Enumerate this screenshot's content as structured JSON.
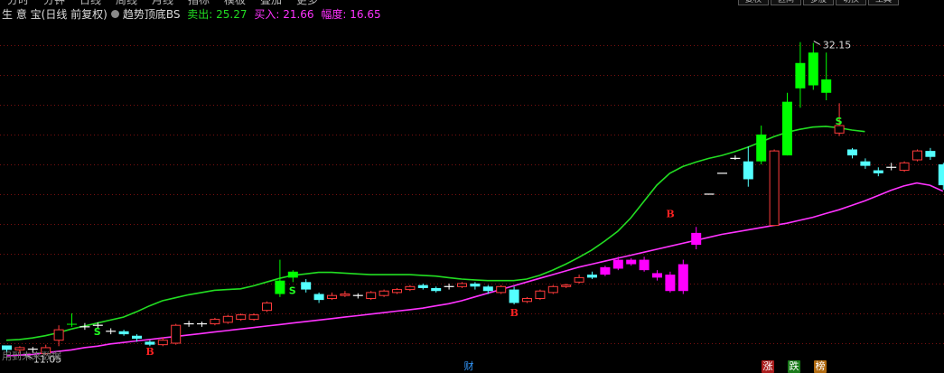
{
  "menu": {
    "items": [
      "分时",
      "分钟",
      "日线",
      "周线",
      "月线",
      "指标",
      "模板",
      "叠加",
      "更多"
    ],
    "buttons": [
      "复权",
      "区间",
      "多股",
      "切换",
      "工具"
    ]
  },
  "header": {
    "stock_name": "生 意 宝",
    "period_label": "(日线 前复权)",
    "indicator_name": "趋势顶底BS",
    "sell_text": "卖出: 25.27",
    "buy_text": "买入: 21.66",
    "amplitude_text": "幅度: 16.65"
  },
  "footer": {
    "note": "用到未来数据"
  },
  "markers": {
    "cai": "财",
    "zhang": "涨",
    "die": "跌",
    "bang": "榜"
  },
  "colors": {
    "background": "#000000",
    "grid": "#7a1010",
    "up_candle": "#ff3b3b",
    "down_candle": "#54ffff",
    "upper_band": "#22dd22",
    "lower_band": "#ff33ff",
    "sell_candle": "#00ff00",
    "buy_candle": "#ff00ff",
    "buy_signal": "#ff2222",
    "sell_signal": "#22ff22",
    "annotation": "#dddddd"
  },
  "chart_data": {
    "type": "candlestick",
    "ylim": [
      10,
      34.3
    ],
    "grid_y": [
      32,
      30,
      28,
      26,
      24,
      22,
      20,
      18,
      16,
      14,
      12
    ],
    "candles": [
      {
        "o": 11.85,
        "c": 11.55,
        "h": 11.85,
        "l": 11.4,
        "t": "down"
      },
      {
        "o": 11.55,
        "c": 11.7,
        "h": 11.8,
        "l": 11.3,
        "t": "up"
      },
      {
        "o": 11.6,
        "c": 11.6,
        "h": 11.75,
        "l": 11.35,
        "t": "doji"
      },
      {
        "o": 11.3,
        "c": 11.7,
        "h": 11.9,
        "l": 11.2,
        "t": "up"
      },
      {
        "o": 12.2,
        "c": 12.9,
        "h": 13.2,
        "l": 11.8,
        "t": "up"
      },
      {
        "o": 13.3,
        "c": 13.25,
        "h": 14.0,
        "l": 13.1,
        "t": "sell"
      },
      {
        "o": 13.1,
        "c": 13.1,
        "h": 13.35,
        "l": 12.9,
        "t": "doji"
      },
      {
        "o": 13.2,
        "c": 13.2,
        "h": 13.4,
        "l": 13.0,
        "t": "doji"
      },
      {
        "o": 12.8,
        "c": 12.8,
        "h": 13.0,
        "l": 12.6,
        "t": "doji"
      },
      {
        "o": 12.8,
        "c": 12.6,
        "h": 12.9,
        "l": 12.5,
        "t": "down"
      },
      {
        "o": 12.5,
        "c": 12.3,
        "h": 12.6,
        "l": 12.1,
        "t": "down"
      },
      {
        "o": 12.1,
        "c": 11.9,
        "h": 12.2,
        "l": 11.8,
        "t": "down"
      },
      {
        "o": 11.9,
        "c": 12.2,
        "h": 12.4,
        "l": 11.8,
        "t": "up"
      },
      {
        "o": 12.0,
        "c": 13.2,
        "h": 13.3,
        "l": 11.9,
        "t": "up"
      },
      {
        "o": 13.3,
        "c": 13.3,
        "h": 13.5,
        "l": 13.1,
        "t": "doji"
      },
      {
        "o": 13.3,
        "c": 13.3,
        "h": 13.45,
        "l": 13.1,
        "t": "doji"
      },
      {
        "o": 13.3,
        "c": 13.6,
        "h": 13.7,
        "l": 13.2,
        "t": "up"
      },
      {
        "o": 13.4,
        "c": 13.8,
        "h": 13.9,
        "l": 13.3,
        "t": "up"
      },
      {
        "o": 13.6,
        "c": 13.9,
        "h": 14.0,
        "l": 13.5,
        "t": "up"
      },
      {
        "o": 13.6,
        "c": 13.9,
        "h": 14.0,
        "l": 13.5,
        "t": "up"
      },
      {
        "o": 14.2,
        "c": 14.7,
        "h": 14.8,
        "l": 14.1,
        "t": "up"
      },
      {
        "o": 15.3,
        "c": 16.2,
        "h": 17.6,
        "l": 15.1,
        "t": "sell"
      },
      {
        "o": 16.8,
        "c": 16.4,
        "h": 16.9,
        "l": 16.1,
        "t": "sell"
      },
      {
        "o": 16.1,
        "c": 15.6,
        "h": 16.3,
        "l": 15.4,
        "t": "down"
      },
      {
        "o": 15.3,
        "c": 14.9,
        "h": 15.4,
        "l": 14.7,
        "t": "down"
      },
      {
        "o": 15.0,
        "c": 15.2,
        "h": 15.4,
        "l": 14.9,
        "t": "up"
      },
      {
        "o": 15.2,
        "c": 15.3,
        "h": 15.5,
        "l": 15.1,
        "t": "up"
      },
      {
        "o": 15.2,
        "c": 15.2,
        "h": 15.35,
        "l": 15.0,
        "t": "doji"
      },
      {
        "o": 15.0,
        "c": 15.4,
        "h": 15.5,
        "l": 14.9,
        "t": "up"
      },
      {
        "o": 15.2,
        "c": 15.5,
        "h": 15.6,
        "l": 15.1,
        "t": "up"
      },
      {
        "o": 15.4,
        "c": 15.6,
        "h": 15.7,
        "l": 15.3,
        "t": "up"
      },
      {
        "o": 15.6,
        "c": 15.8,
        "h": 15.9,
        "l": 15.5,
        "t": "up"
      },
      {
        "o": 15.9,
        "c": 15.7,
        "h": 16.0,
        "l": 15.6,
        "t": "down"
      },
      {
        "o": 15.7,
        "c": 15.5,
        "h": 15.8,
        "l": 15.4,
        "t": "down"
      },
      {
        "o": 15.8,
        "c": 15.8,
        "h": 16.0,
        "l": 15.6,
        "t": "doji"
      },
      {
        "o": 15.8,
        "c": 16.0,
        "h": 16.1,
        "l": 15.7,
        "t": "up"
      },
      {
        "o": 16.0,
        "c": 15.8,
        "h": 16.1,
        "l": 15.6,
        "t": "down"
      },
      {
        "o": 15.8,
        "c": 15.5,
        "h": 15.9,
        "l": 15.3,
        "t": "down"
      },
      {
        "o": 15.4,
        "c": 15.8,
        "h": 15.9,
        "l": 15.3,
        "t": "up"
      },
      {
        "o": 15.6,
        "c": 14.7,
        "h": 15.8,
        "l": 14.6,
        "t": "down"
      },
      {
        "o": 14.8,
        "c": 15.0,
        "h": 15.1,
        "l": 14.7,
        "t": "up"
      },
      {
        "o": 15.0,
        "c": 15.5,
        "h": 15.6,
        "l": 14.9,
        "t": "up"
      },
      {
        "o": 15.4,
        "c": 15.8,
        "h": 15.9,
        "l": 15.3,
        "t": "up"
      },
      {
        "o": 15.8,
        "c": 15.9,
        "h": 16.0,
        "l": 15.7,
        "t": "up"
      },
      {
        "o": 16.1,
        "c": 16.4,
        "h": 16.6,
        "l": 16.0,
        "t": "up"
      },
      {
        "o": 16.6,
        "c": 16.4,
        "h": 16.8,
        "l": 16.3,
        "t": "down"
      },
      {
        "o": 16.6,
        "c": 17.1,
        "h": 17.2,
        "l": 16.5,
        "t": "buy"
      },
      {
        "o": 17.0,
        "c": 17.6,
        "h": 17.8,
        "l": 16.9,
        "t": "buy"
      },
      {
        "o": 17.3,
        "c": 17.6,
        "h": 17.7,
        "l": 17.2,
        "t": "buy"
      },
      {
        "o": 17.6,
        "c": 16.9,
        "h": 17.8,
        "l": 16.8,
        "t": "buy"
      },
      {
        "o": 16.7,
        "c": 16.4,
        "h": 16.9,
        "l": 16.2,
        "t": "buy"
      },
      {
        "o": 16.6,
        "c": 15.5,
        "h": 16.8,
        "l": 15.4,
        "t": "buy"
      },
      {
        "o": 15.5,
        "c": 17.3,
        "h": 17.6,
        "l": 15.3,
        "t": "buy"
      },
      {
        "o": 18.6,
        "c": 19.4,
        "h": 19.8,
        "l": 18.3,
        "t": "buy"
      },
      {
        "o": 22.0,
        "c": 22.0,
        "h": 22.0,
        "l": 22.0,
        "t": "doji"
      },
      {
        "o": 23.4,
        "c": 23.4,
        "h": 23.4,
        "l": 23.4,
        "t": "doji"
      },
      {
        "o": 24.4,
        "c": 24.4,
        "h": 24.6,
        "l": 24.3,
        "t": "doji"
      },
      {
        "o": 23.0,
        "c": 24.2,
        "h": 25.2,
        "l": 22.5,
        "t": "down"
      },
      {
        "o": 24.2,
        "c": 26.0,
        "h": 26.6,
        "l": 24.0,
        "t": "sell"
      },
      {
        "o": 24.9,
        "c": 19.9,
        "h": 25.0,
        "l": 19.9,
        "t": "up"
      },
      {
        "o": 24.6,
        "c": 28.2,
        "h": 28.8,
        "l": 24.6,
        "t": "sell"
      },
      {
        "o": 29.1,
        "c": 30.8,
        "h": 32.2,
        "l": 27.8,
        "t": "sell"
      },
      {
        "o": 29.3,
        "c": 31.5,
        "h": 32.15,
        "l": 29.0,
        "t": "sell"
      },
      {
        "o": 29.7,
        "c": 28.8,
        "h": 31.5,
        "l": 28.3,
        "t": "sell"
      },
      {
        "o": 26.6,
        "c": 26.1,
        "h": 28.1,
        "l": 25.9,
        "t": "up"
      },
      {
        "o": 25.0,
        "c": 24.6,
        "h": 25.1,
        "l": 24.4,
        "t": "down"
      },
      {
        "o": 24.2,
        "c": 23.9,
        "h": 24.4,
        "l": 23.7,
        "t": "down"
      },
      {
        "o": 23.6,
        "c": 23.4,
        "h": 23.8,
        "l": 23.2,
        "t": "down"
      },
      {
        "o": 23.8,
        "c": 23.8,
        "h": 24.1,
        "l": 23.6,
        "t": "doji"
      },
      {
        "o": 23.6,
        "c": 24.1,
        "h": 24.2,
        "l": 23.5,
        "t": "up"
      },
      {
        "o": 24.3,
        "c": 24.9,
        "h": 25.0,
        "l": 24.2,
        "t": "up"
      },
      {
        "o": 24.9,
        "c": 24.5,
        "h": 25.1,
        "l": 24.3,
        "t": "down"
      },
      {
        "o": 24.0,
        "c": 22.6,
        "h": 24.1,
        "l": 22.3,
        "t": "down"
      },
      {
        "o": 22.5,
        "c": 21.8,
        "h": 22.6,
        "l": 21.5,
        "t": "buy"
      }
    ],
    "upper_band": [
      12.2,
      12.25,
      12.35,
      12.5,
      12.7,
      12.95,
      13.15,
      13.35,
      13.55,
      13.75,
      14.1,
      14.5,
      14.85,
      15.05,
      15.25,
      15.4,
      15.55,
      15.6,
      15.65,
      15.85,
      16.1,
      16.35,
      16.55,
      16.65,
      16.75,
      16.75,
      16.7,
      16.65,
      16.6,
      16.6,
      16.6,
      16.6,
      16.55,
      16.5,
      16.4,
      16.3,
      16.25,
      16.2,
      16.2,
      16.2,
      16.3,
      16.55,
      16.9,
      17.3,
      17.75,
      18.25,
      18.85,
      19.5,
      20.4,
      21.5,
      22.6,
      23.4,
      23.85,
      24.15,
      24.4,
      24.6,
      24.85,
      25.15,
      25.5,
      25.85,
      26.15,
      26.35,
      26.5,
      26.55,
      26.45,
      26.3,
      26.2
    ],
    "upper_band_x_start": 0,
    "lower_band": [
      11.15,
      11.2,
      11.25,
      11.35,
      11.45,
      11.55,
      11.7,
      11.8,
      11.95,
      12.05,
      12.15,
      12.25,
      12.35,
      12.45,
      12.55,
      12.65,
      12.75,
      12.85,
      12.95,
      13.05,
      13.15,
      13.25,
      13.35,
      13.45,
      13.55,
      13.65,
      13.75,
      13.85,
      13.95,
      14.05,
      14.15,
      14.25,
      14.35,
      14.5,
      14.65,
      14.85,
      15.1,
      15.35,
      15.6,
      15.85,
      16.1,
      16.35,
      16.6,
      16.85,
      17.1,
      17.3,
      17.5,
      17.7,
      17.9,
      18.1,
      18.3,
      18.5,
      18.7,
      18.9,
      19.1,
      19.3,
      19.45,
      19.6,
      19.75,
      19.9,
      20.05,
      20.25,
      20.45,
      20.7,
      20.95,
      21.25,
      21.55,
      21.9,
      22.25,
      22.55,
      22.75,
      22.6,
      22.2
    ],
    "signals": [
      {
        "i": 2,
        "type": "buy_arrow"
      },
      {
        "i": 7,
        "type": "S",
        "p": 12.8
      },
      {
        "i": 11,
        "type": "B",
        "p": 11.45
      },
      {
        "i": 22,
        "type": "S",
        "p": 15.55
      },
      {
        "i": 39,
        "type": "B",
        "p": 14.05
      },
      {
        "i": 51,
        "type": "B",
        "p": 20.7
      },
      {
        "i": 64,
        "type": "S",
        "p": 26.9
      }
    ],
    "annotations": {
      "high_label": "32.15",
      "low_label": "11.05"
    }
  }
}
